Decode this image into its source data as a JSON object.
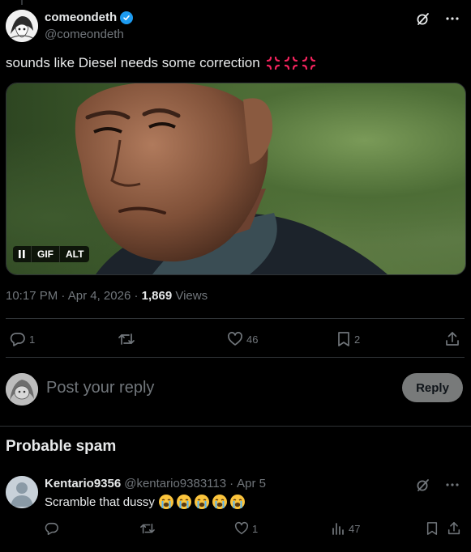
{
  "post": {
    "display_name": "comeondeth",
    "handle": "@comeondeth",
    "text": "sounds like Diesel needs some correction",
    "text_emojis": [
      "anger-symbol",
      "anger-symbol",
      "anger-symbol"
    ],
    "media": {
      "type_badge": "GIF",
      "alt_badge": "ALT",
      "paused": true
    },
    "meta": {
      "time": "10:17 PM",
      "sep1": " · ",
      "date": "Apr 4, 2026",
      "sep2": " · ",
      "views_count": "1,869",
      "views_label": "Views"
    },
    "actions": {
      "replies": "1",
      "reposts": "",
      "likes": "46",
      "bookmarks": "2"
    }
  },
  "reply_composer": {
    "placeholder": "Post your reply",
    "button_label": "Reply"
  },
  "section_title": "Probable spam",
  "reply": {
    "display_name": "Kentario9356",
    "handle": "@kentario9383113",
    "sep": "·",
    "date": "Apr 5",
    "text": "Scramble that dussy",
    "text_emojis": [
      "loudly-crying-face",
      "loudly-crying-face",
      "loudly-crying-face",
      "loudly-crying-face",
      "loudly-crying-face"
    ],
    "actions": {
      "replies": "",
      "reposts": "",
      "likes": "1",
      "views": "47"
    }
  },
  "colors": {
    "background": "#000000",
    "text_primary": "#e7e9ea",
    "text_secondary": "#71767b",
    "divider": "#2f3336",
    "verified": "#1d9bf0",
    "reply_button": "#787a7a"
  }
}
